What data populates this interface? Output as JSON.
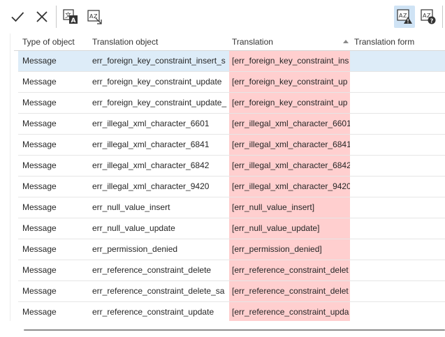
{
  "toolbar": {
    "icons": [
      "checkmark-icon",
      "close-icon",
      "translate-text-icon",
      "translate-format-icon",
      "translation-warning-icon",
      "translation-help-icon"
    ],
    "active_icon": "translation-warning-icon"
  },
  "columns": {
    "type": "Type of object",
    "object": "Translation object",
    "translation": "Translation",
    "form": "Translation form"
  },
  "rows": [
    {
      "type": "Message",
      "object": "err_foreign_key_constraint_insert_s",
      "translation": "[err_foreign_key_constraint_ins",
      "form": ""
    },
    {
      "type": "Message",
      "object": "err_foreign_key_constraint_update",
      "translation": "[err_foreign_key_constraint_up",
      "form": ""
    },
    {
      "type": "Message",
      "object": "err_foreign_key_constraint_update_",
      "translation": "[err_foreign_key_constraint_up",
      "form": ""
    },
    {
      "type": "Message",
      "object": "err_illegal_xml_character_6601",
      "translation": "[err_illegal_xml_character_6601",
      "form": ""
    },
    {
      "type": "Message",
      "object": "err_illegal_xml_character_6841",
      "translation": "[err_illegal_xml_character_6841",
      "form": ""
    },
    {
      "type": "Message",
      "object": "err_illegal_xml_character_6842",
      "translation": "[err_illegal_xml_character_6842",
      "form": ""
    },
    {
      "type": "Message",
      "object": "err_illegal_xml_character_9420",
      "translation": "[err_illegal_xml_character_9420",
      "form": ""
    },
    {
      "type": "Message",
      "object": "err_null_value_insert",
      "translation": "[err_null_value_insert]",
      "form": ""
    },
    {
      "type": "Message",
      "object": "err_null_value_update",
      "translation": "[err_null_value_update]",
      "form": ""
    },
    {
      "type": "Message",
      "object": "err_permission_denied",
      "translation": "[err_permission_denied]",
      "form": ""
    },
    {
      "type": "Message",
      "object": "err_reference_constraint_delete",
      "translation": "[err_reference_constraint_delet",
      "form": ""
    },
    {
      "type": "Message",
      "object": "err_reference_constraint_delete_sa",
      "translation": "[err_reference_constraint_delet",
      "form": ""
    },
    {
      "type": "Message",
      "object": "err_reference_constraint_update",
      "translation": "[err_reference_constraint_upda",
      "form": ""
    }
  ],
  "colors": {
    "untranslated_highlight": "#ffcfcf",
    "selected_row": "#ddecf8",
    "active_tool": "#cfe3f5"
  }
}
